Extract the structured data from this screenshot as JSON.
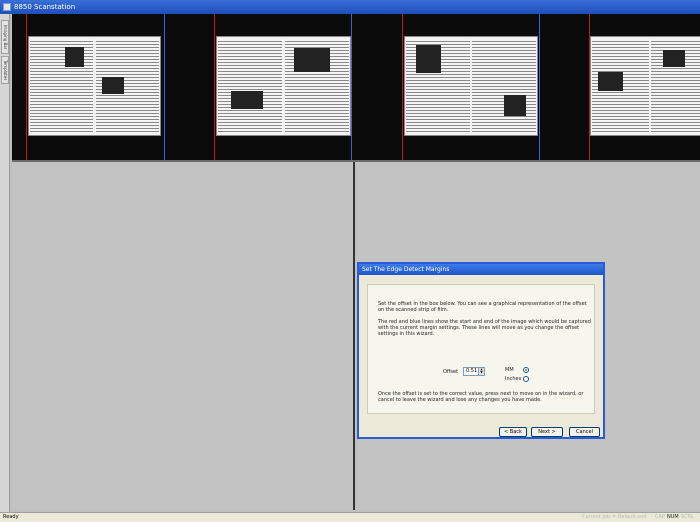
{
  "window": {
    "title": "8850 Scanstation"
  },
  "side_tabs": [
    "Imaging Bar",
    "Templates"
  ],
  "dialog": {
    "title": "Set The Edge Detect Margins",
    "para1": "Set the offset in the box below. You can see a graphical representation of the offset on the scanned strip of film.",
    "para2": "The red and blue lines show the start and end of the image which would be captured with the current margin settings. These lines will move as you change the offset settings in this wizard.",
    "para3": "Once the offset is set to the correct value, press next to move on in the wizard, or cancel to leave the wizard and lose any changes you have made.",
    "offset_label": "Offset",
    "offset_value": "0.51",
    "unit_mm": "MM",
    "unit_inches": "Inches",
    "selected_unit": "MM",
    "back_label": "< Back",
    "next_label": "Next >",
    "cancel_label": "Cancel"
  },
  "status": {
    "left": "Ready",
    "job": "Current Job = Default.xml",
    "keys": [
      "CAP",
      "NUM",
      "SCRL"
    ]
  },
  "colors": {
    "title_bar": "#1f4fb8",
    "edge_start": "#c4161c",
    "edge_end": "#4a5cd0",
    "film": "#0b0b0b"
  }
}
